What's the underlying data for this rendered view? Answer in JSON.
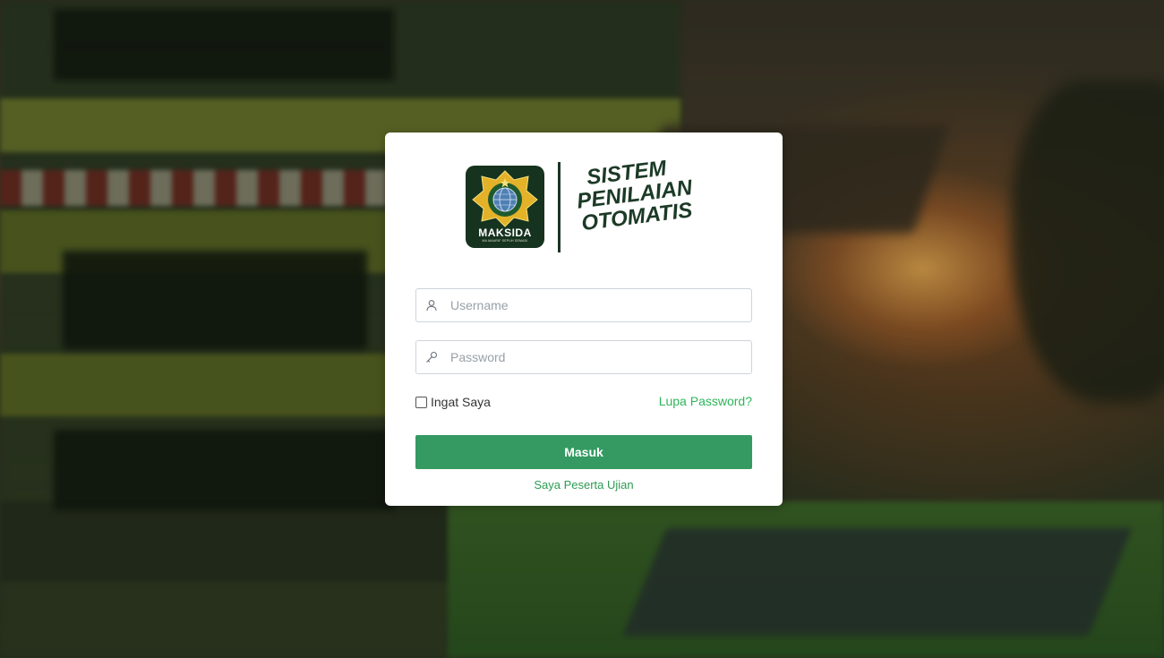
{
  "app": {
    "emblem_name": "MAKSIDA",
    "emblem_subtitle": "MA MAARIF SEPUH SEMADI",
    "title_line1": "SISTEM",
    "title_line2": "PENILAIAN",
    "title_line3": "OTOMATIS"
  },
  "login": {
    "username_placeholder": "Username",
    "password_placeholder": "Password",
    "remember_label": "Ingat Saya",
    "forgot_label": "Lupa Password?",
    "submit_label": "Masuk",
    "participant_link": "Saya Peserta Ujian"
  },
  "icons": {
    "username": "user-icon",
    "password": "key-icon"
  },
  "colors": {
    "primary": "#349a61",
    "link": "#2eb55a",
    "brand_dark": "#1c3a26",
    "emblem_bg": "#16331f",
    "emblem_gold": "#e3b229"
  }
}
